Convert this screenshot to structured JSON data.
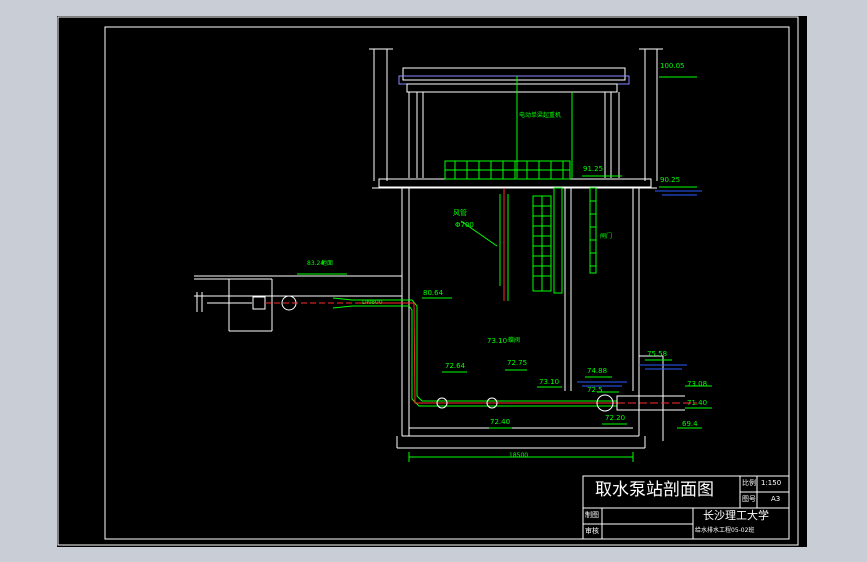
{
  "colors": {
    "viewport_bg": "#c9cdd6",
    "sheet_bg": "#000000",
    "frame": "#ffffff",
    "annotation": "#00ff00",
    "pipe": "#ff2a2a",
    "water": "#2a5cff"
  },
  "title_block": {
    "drawing_title": "取水泵站剖面图",
    "scale_label": "比例",
    "scale_value": "1:150",
    "sheet_no_label": "图号",
    "sheet_no_value": "A3",
    "drawn_by_label": "制图",
    "checked_by_label": "审核",
    "institution": "长沙理工大学",
    "class_label": "给水排水工程05-02班"
  },
  "elevations": {
    "roof": "100.05",
    "operating_floor": "91.25",
    "flood_level": "90.25",
    "ground": "83.24",
    "pipe_center": "80.64",
    "valve_level": "73.10",
    "left_floor": "72.64",
    "suction_pipe": "72.75",
    "mid_pipe": "73.10",
    "low_water": "74.88",
    "river_level": "75.58",
    "intake": "73.08",
    "outlet": "72.5",
    "base": "72.40",
    "bottom_left": "71.40",
    "bottom_right": "72.20",
    "river_bed": "69.4"
  },
  "labels": {
    "air_duct": "风管",
    "duct_diameter": "Φ700",
    "gate_note": "闸门",
    "crane_note": "电动单梁起重机",
    "ground_note": "地面",
    "pipe_dn": "DN800",
    "valve_note": "蝶阀",
    "width_dim": "18500"
  }
}
